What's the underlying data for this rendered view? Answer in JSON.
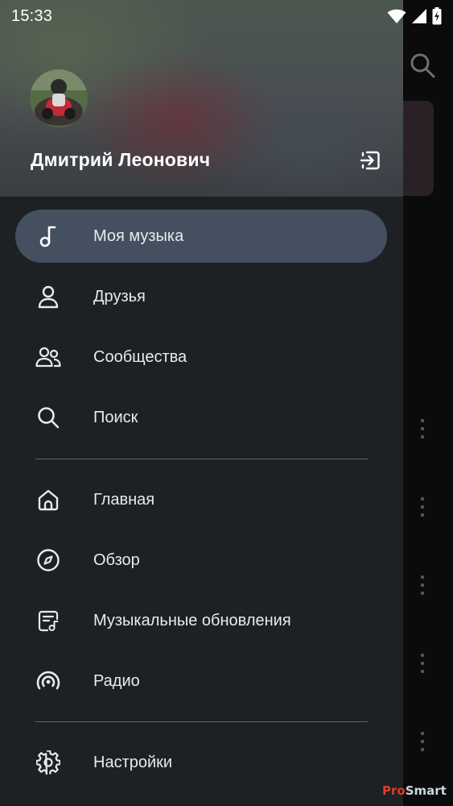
{
  "status_bar": {
    "time": "15:33",
    "icons": [
      "wifi-icon",
      "cell-signal-icon",
      "battery-charging-icon"
    ]
  },
  "background_app": {
    "icons": [
      "search-icon",
      "more-vert-icon"
    ]
  },
  "drawer": {
    "user": {
      "name": "Дмитрий Леонович",
      "avatar": "avatar-photo",
      "logout_icon": "logout-icon"
    },
    "primary_items": [
      {
        "label": "Моя музыка",
        "icon": "music-note-icon",
        "active": true
      },
      {
        "label": "Друзья",
        "icon": "person-icon",
        "active": false
      },
      {
        "label": "Сообщества",
        "icon": "group-icon",
        "active": false
      },
      {
        "label": "Поиск",
        "icon": "search-icon",
        "active": false
      }
    ],
    "secondary_items": [
      {
        "label": "Главная",
        "icon": "home-icon"
      },
      {
        "label": "Обзор",
        "icon": "compass-icon"
      },
      {
        "label": "Музыкальные обновления",
        "icon": "music-updates-icon"
      },
      {
        "label": "Радио",
        "icon": "radio-icon"
      }
    ],
    "settings_item": {
      "label": "Настройки",
      "icon": "gear-icon"
    }
  },
  "watermark": {
    "prefix": "Pro",
    "suffix": "Smart"
  },
  "colors": {
    "drawer_bg": "#1e2124",
    "active_item_bg": "#44505f",
    "text": "#e8eaed",
    "divider": "#5f6368"
  }
}
